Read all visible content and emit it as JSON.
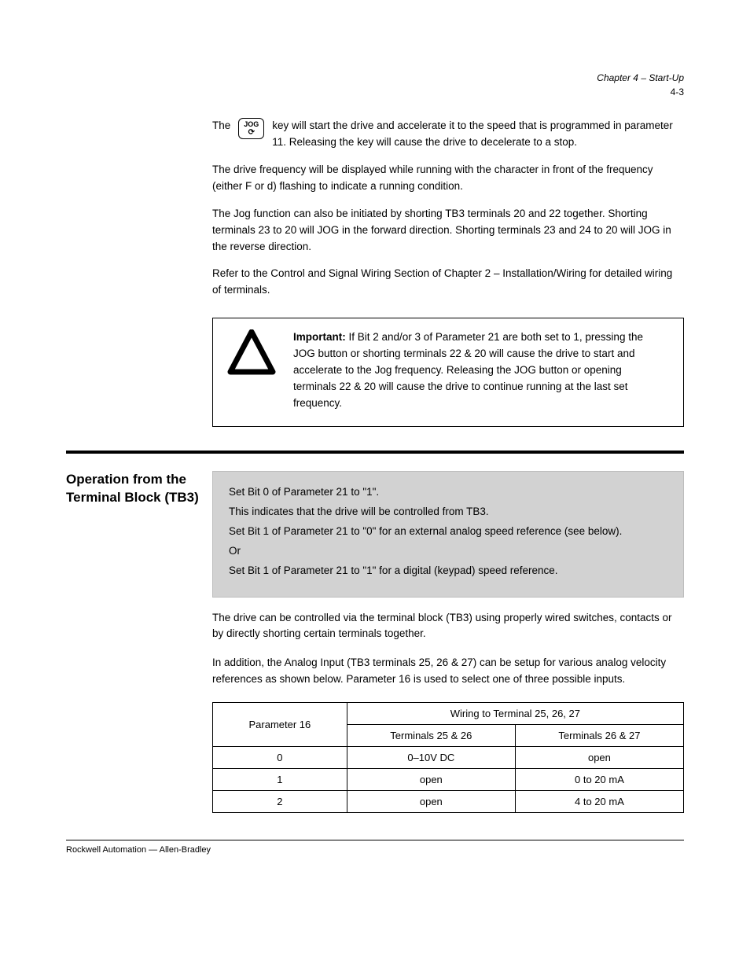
{
  "header": {
    "chapter": "Chapter 4 – Start-Up",
    "page_number": "4-3"
  },
  "jog": {
    "key_label": "JOG",
    "key_arrow": "⟳",
    "para1_prefix": "The ",
    "para1_rest": " key will start the drive and accelerate it to the speed that is programmed in parameter 11. Releasing the key will cause the drive to decelerate to a stop."
  },
  "paragraphs": {
    "p2": "The drive frequency will be displayed while running with the character in front of the frequency (either F or d) flashing to indicate a running condition.",
    "p3": "The Jog function can also be initiated by shorting TB3 terminals 20 and 22 together. Shorting terminals 23 to 20 will JOG in the forward direction. Shorting terminals 23 and 24 to 20 will JOG in the reverse direction.",
    "p4": "Refer to the Control and Signal Wiring Section of Chapter 2 – Installation/Wiring for detailed wiring of terminals."
  },
  "important": {
    "head": "Important:",
    "text": " If Bit 2 and/or 3 of Parameter 21 are both set to 1, pressing the JOG button or shorting terminals 22 & 20 will cause the drive to start and accelerate to the Jog frequency. Releasing the JOG button or opening terminals 22 & 20 will cause the drive to continue running at the last set frequency."
  },
  "section": {
    "label": "Operation from the Terminal Block (TB3)",
    "gray": {
      "l1": "Set Bit 0 of Parameter 21 to \"1\".",
      "l2": "This indicates that the drive will be controlled from TB3.",
      "l3": "Set Bit 1 of Parameter 21 to \"0\" for an external analog speed reference (see below).",
      "l4": "Or",
      "l5": "Set Bit 1 of Parameter 21 to \"1\" for a digital (keypad) speed reference."
    },
    "after_gray_1": "The drive can be controlled via the terminal block (TB3) using properly wired switches, contacts or by directly shorting certain terminals together.",
    "after_gray_2": "In addition, the Analog Input (TB3 terminals 25, 26 & 27) can be setup for various analog velocity references as shown below. Parameter 16 is used to select one of three possible inputs."
  },
  "table": {
    "rowhead": "Parameter 16",
    "head1": "Wiring to Terminal 25, 26, 27",
    "head2a": "Terminals 25 & 26",
    "head2b": "Terminals 26 & 27",
    "rows": [
      {
        "p": "0",
        "a": "0–10V DC",
        "b": "open"
      },
      {
        "p": "1",
        "a": "open",
        "b": "0 to 20 mA"
      },
      {
        "p": "2",
        "a": "open",
        "b": "4 to 20 mA"
      }
    ]
  },
  "footer": {
    "left": "Rockwell Automation — Allen-Bradley",
    "right": ""
  }
}
